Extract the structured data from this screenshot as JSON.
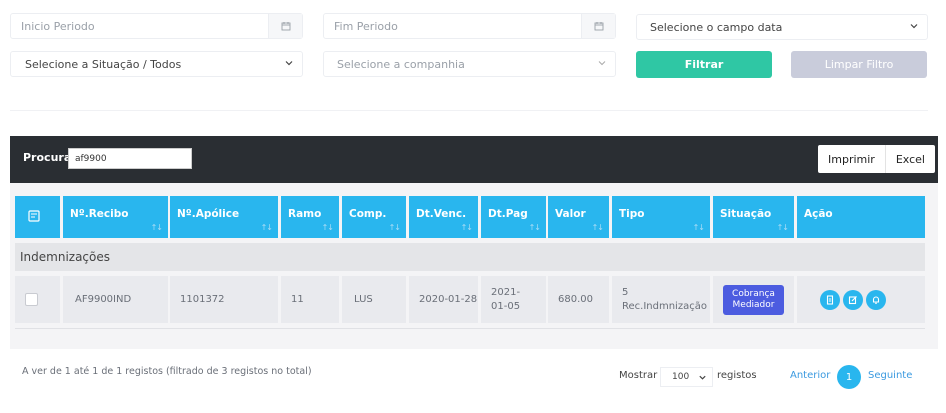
{
  "filters": {
    "inicio_placeholder": "Inicio Periodo",
    "fim_placeholder": "Fim Periodo",
    "campo_data": "Selecione o campo data",
    "situacao": "Selecione a Situação / Todos",
    "companhia": "Selecione a companhia",
    "filtrar_label": "Filtrar",
    "limpar_label": "Limpar Filtro"
  },
  "toolbar": {
    "search_label": "Procurar:",
    "search_value": "af9900",
    "imprimir_label": "Imprimir",
    "excel_label": "Excel"
  },
  "table": {
    "columns": [
      "Nº.Recibo",
      "Nº.Apólice",
      "Ramo",
      "Comp.",
      "Dt.Venc.",
      "Dt.Pag",
      "Valor",
      "Tipo",
      "Situação",
      "Ação"
    ],
    "group_label": "Indemnizações",
    "row": {
      "recibo": "AF9900IND",
      "apolice": "1101372",
      "ramo": "11",
      "comp": "LUS",
      "dt_venc": "2020-01-28",
      "dt_pag": "2021-01-05",
      "valor": "680.00",
      "tipo": "5 Rec.Indmnização",
      "situacao": "Cobrança Mediador"
    }
  },
  "footer": {
    "info": "A ver de 1 até 1 de 1 registos (filtrado de 3 registos no total)",
    "mostrar_label": "Mostrar",
    "page_length": "100",
    "registos_label": "registos",
    "anterior_label": "Anterior",
    "current_page": "1",
    "seguinte_label": "Seguinte"
  },
  "colors": {
    "accent": "#29b6ee",
    "filter_button": "#2fc7a4",
    "badge": "#4c5ce0",
    "dark_bar": "#2a2e33"
  }
}
